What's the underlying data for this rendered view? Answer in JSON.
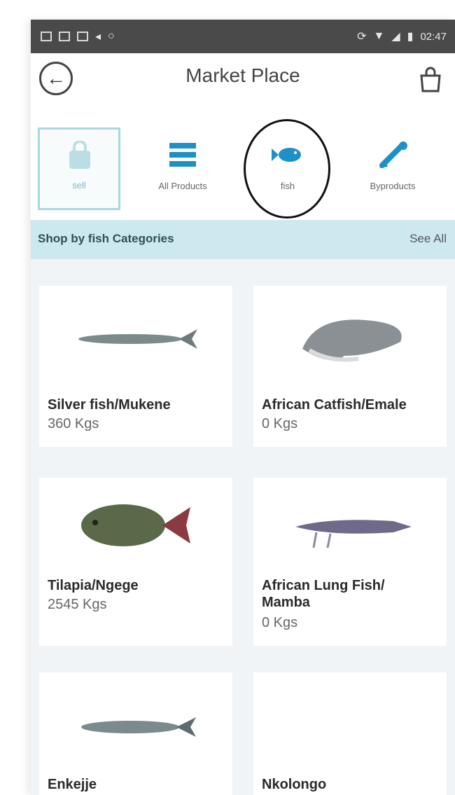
{
  "header": {
    "title": "Market Place"
  },
  "tabs": [
    {
      "label": "sell"
    },
    {
      "label": "All Products"
    },
    {
      "label": "fish"
    },
    {
      "label": "Byproducts"
    }
  ],
  "category_bar": {
    "title": "Shop by  fish Categories",
    "see_all": "See All"
  },
  "products": [
    {
      "name": "Silver fish/Mukene",
      "qty": "360 Kgs"
    },
    {
      "name": "African Catfish/Emale",
      "qty": "0 Kgs"
    },
    {
      "name": "Tilapia/Ngege",
      "qty": "2545 Kgs"
    },
    {
      "name": "African Lung Fish/ Mamba",
      "qty": "0 Kgs"
    },
    {
      "name": "Enkejje",
      "qty": ""
    },
    {
      "name": "Nkolongo",
      "qty": ""
    }
  ],
  "status_bar": {
    "time": "02:47"
  },
  "colors": {
    "accent": "#1e90c8",
    "category_bar": "#cde9ef"
  }
}
